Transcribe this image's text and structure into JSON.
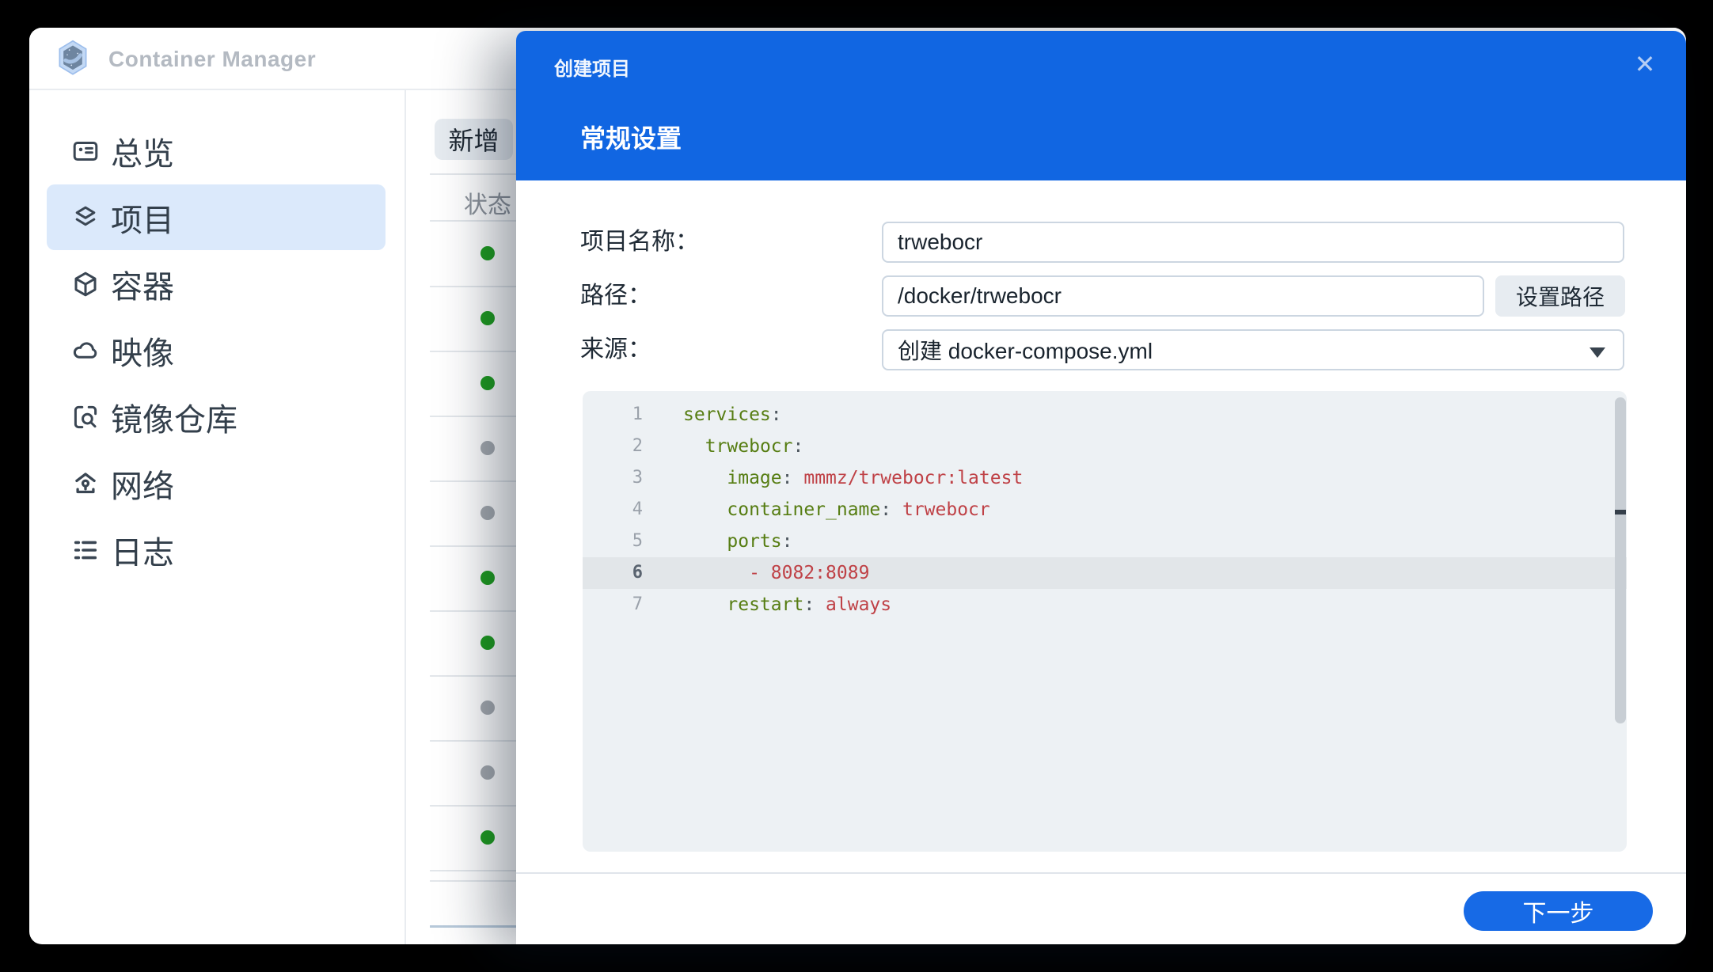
{
  "app": {
    "title": "Container Manager"
  },
  "sidebar": {
    "items": [
      {
        "id": "overview",
        "label": "总览",
        "icon": "overview-icon",
        "active": false
      },
      {
        "id": "project",
        "label": "项目",
        "icon": "projects-icon",
        "active": true
      },
      {
        "id": "container",
        "label": "容器",
        "icon": "container-icon",
        "active": false
      },
      {
        "id": "image",
        "label": "映像",
        "icon": "image-icon",
        "active": false
      },
      {
        "id": "registry",
        "label": "镜像仓库",
        "icon": "registry-icon",
        "active": false
      },
      {
        "id": "network",
        "label": "网络",
        "icon": "network-icon",
        "active": false
      },
      {
        "id": "log",
        "label": "日志",
        "icon": "log-icon",
        "active": false
      }
    ]
  },
  "content": {
    "add_button": "新增",
    "status_header": "状态",
    "status_dots": [
      "green",
      "green",
      "green",
      "gray",
      "gray",
      "green",
      "green",
      "gray",
      "gray",
      "green"
    ]
  },
  "modal": {
    "title": "创建项目",
    "close_icon": "✕",
    "section_title": "常规设置",
    "form": {
      "project_name_label": "项目名称：",
      "project_name_value": "trwebocr",
      "path_label": "路径：",
      "path_value": "/docker/trwebocr",
      "path_button": "设置路径",
      "source_label": "来源：",
      "source_value": "创建 docker-compose.yml"
    },
    "editor": {
      "lines": [
        {
          "num": "1",
          "active": false,
          "segments": [
            [
              "key",
              "services"
            ],
            [
              "colon",
              ":"
            ]
          ]
        },
        {
          "num": "2",
          "active": false,
          "segments": [
            [
              "plain",
              "  "
            ],
            [
              "key",
              "trwebocr"
            ],
            [
              "colon",
              ":"
            ]
          ]
        },
        {
          "num": "3",
          "active": false,
          "segments": [
            [
              "plain",
              "    "
            ],
            [
              "key",
              "image"
            ],
            [
              "colon",
              ":"
            ],
            [
              "val",
              " mmmz/trwebocr:latest"
            ]
          ]
        },
        {
          "num": "4",
          "active": false,
          "segments": [
            [
              "plain",
              "    "
            ],
            [
              "key",
              "container_name"
            ],
            [
              "colon",
              ":"
            ],
            [
              "val",
              " trwebocr"
            ]
          ]
        },
        {
          "num": "5",
          "active": false,
          "segments": [
            [
              "plain",
              "    "
            ],
            [
              "key",
              "ports"
            ],
            [
              "colon",
              ":"
            ]
          ]
        },
        {
          "num": "6",
          "active": true,
          "segments": [
            [
              "plain",
              "      "
            ],
            [
              "val",
              "- 8082:8089"
            ]
          ]
        },
        {
          "num": "7",
          "active": false,
          "segments": [
            [
              "plain",
              "    "
            ],
            [
              "key",
              "restart"
            ],
            [
              "colon",
              ":"
            ],
            [
              "val",
              " always"
            ]
          ]
        }
      ]
    },
    "footer": {
      "next_button": "下一步"
    }
  },
  "colors": {
    "accent_blue": "#1166e2",
    "button_blue": "#176ae6",
    "selected_item_bg": "#dbe9fb",
    "status_green": "#1f9d1f",
    "status_gray": "#a6abb0",
    "code_key_green": "#567d12",
    "code_value_red": "#bf4146",
    "editor_bg": "#edf1f4"
  }
}
